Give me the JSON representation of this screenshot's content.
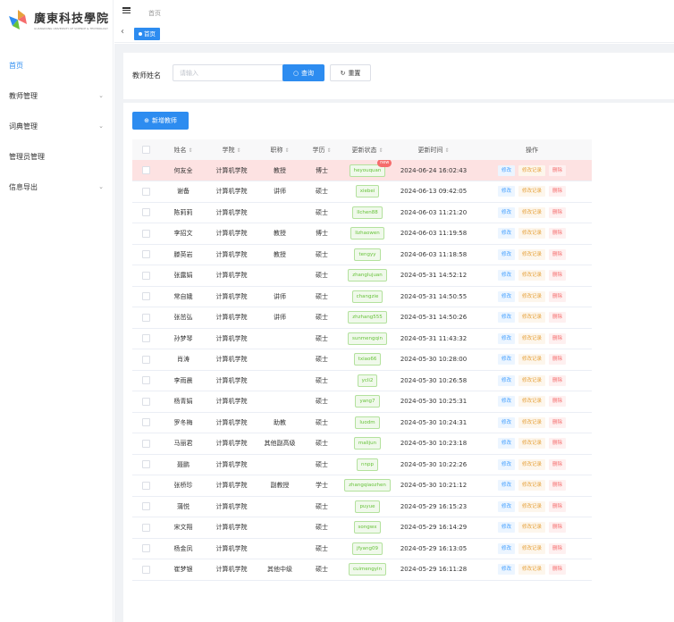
{
  "logo": {
    "cn": "廣東科技學院",
    "en": "GUANGDONG UNIVERSITY OF SCIENCE & TECHNOLOGY"
  },
  "sidebar": {
    "items": [
      {
        "label": "首页",
        "expandable": false,
        "active": true
      },
      {
        "label": "教师管理",
        "expandable": true
      },
      {
        "label": "词典管理",
        "expandable": true
      },
      {
        "label": "管理员管理",
        "expandable": false
      },
      {
        "label": "信息导出",
        "expandable": true
      }
    ]
  },
  "header": {
    "breadcrumb": "首页",
    "tab": "首页"
  },
  "search": {
    "label": "教师姓名",
    "placeholder": "请输入",
    "query_label": "查询",
    "reset_label": "重置"
  },
  "toolbar": {
    "add_label": "新增教师"
  },
  "table": {
    "columns": [
      "姓名",
      "学院",
      "职称",
      "学历",
      "更新状态",
      "更新时间",
      "操作"
    ],
    "actions": {
      "edit": "修改",
      "log": "修改记录",
      "delete": "删除"
    },
    "badge": "new",
    "rows": [
      {
        "name": "何友全",
        "college": "计算机学院",
        "title": "教授",
        "degree": "博士",
        "status": "heyouquan",
        "time": "2024-06-24 16:02:43"
      },
      {
        "name": "谢备",
        "college": "计算机学院",
        "title": "讲师",
        "degree": "硕士",
        "status": "xiebei",
        "time": "2024-06-13 09:42:05"
      },
      {
        "name": "陈莉莉",
        "college": "计算机学院",
        "title": "",
        "degree": "硕士",
        "status": "llchen88",
        "time": "2024-06-03 11:21:20"
      },
      {
        "name": "李招文",
        "college": "计算机学院",
        "title": "教授",
        "degree": "博士",
        "status": "lizhaowen",
        "time": "2024-06-03 11:19:58"
      },
      {
        "name": "滕英岩",
        "college": "计算机学院",
        "title": "教授",
        "degree": "硕士",
        "status": "tengyy",
        "time": "2024-06-03 11:18:58"
      },
      {
        "name": "张露娟",
        "college": "计算机学院",
        "title": "",
        "degree": "硕士",
        "status": "zhanglujuan",
        "time": "2024-05-31 14:52:12"
      },
      {
        "name": "常自娥",
        "college": "计算机学院",
        "title": "讲师",
        "degree": "硕士",
        "status": "changzie",
        "time": "2024-05-31 14:50:55"
      },
      {
        "name": "张茁弘",
        "college": "计算机学院",
        "title": "讲师",
        "degree": "硕士",
        "status": "zhzhang555",
        "time": "2024-05-31 14:50:26"
      },
      {
        "name": "孙梦琴",
        "college": "计算机学院",
        "title": "",
        "degree": "硕士",
        "status": "sunmengqin",
        "time": "2024-05-31 11:43:32"
      },
      {
        "name": "肖涛",
        "college": "计算机学院",
        "title": "",
        "degree": "硕士",
        "status": "txiao66",
        "time": "2024-05-30 10:28:00"
      },
      {
        "name": "李雨晨",
        "college": "计算机学院",
        "title": "",
        "degree": "硕士",
        "status": "ycli2",
        "time": "2024-05-30 10:26:58"
      },
      {
        "name": "杨青娟",
        "college": "计算机学院",
        "title": "",
        "degree": "硕士",
        "status": "yang7",
        "time": "2024-05-30 10:25:31"
      },
      {
        "name": "罗冬梅",
        "college": "计算机学院",
        "title": "助教",
        "degree": "硕士",
        "status": "luodm",
        "time": "2024-05-30 10:24:31"
      },
      {
        "name": "马丽君",
        "college": "计算机学院",
        "title": "其他副高级",
        "degree": "硕士",
        "status": "malijun",
        "time": "2024-05-30 10:23:18"
      },
      {
        "name": "聂鹏",
        "college": "计算机学院",
        "title": "",
        "degree": "硕士",
        "status": "nnpp",
        "time": "2024-05-30 10:22:26"
      },
      {
        "name": "张桥珍",
        "college": "计算机学院",
        "title": "副教授",
        "degree": "学士",
        "status": "zhangqiaozhen",
        "time": "2024-05-30 10:21:12"
      },
      {
        "name": "蒲悦",
        "college": "计算机学院",
        "title": "",
        "degree": "硕士",
        "status": "puyue",
        "time": "2024-05-29 16:15:23"
      },
      {
        "name": "宋文翔",
        "college": "计算机学院",
        "title": "",
        "degree": "硕士",
        "status": "songwx",
        "time": "2024-05-29 16:14:29"
      },
      {
        "name": "杨金凤",
        "college": "计算机学院",
        "title": "",
        "degree": "硕士",
        "status": "jfyang09",
        "time": "2024-05-29 16:13:05"
      },
      {
        "name": "崔梦银",
        "college": "计算机学院",
        "title": "其他中级",
        "degree": "硕士",
        "status": "cuimengyin",
        "time": "2024-05-29 16:11:28"
      }
    ]
  },
  "colors": {
    "primary": "#2d8cf0",
    "highlight_row": "#fde2e2",
    "status_green": "#67c23a",
    "log_orange": "#e6a23c",
    "delete_red": "#f56c6c"
  }
}
